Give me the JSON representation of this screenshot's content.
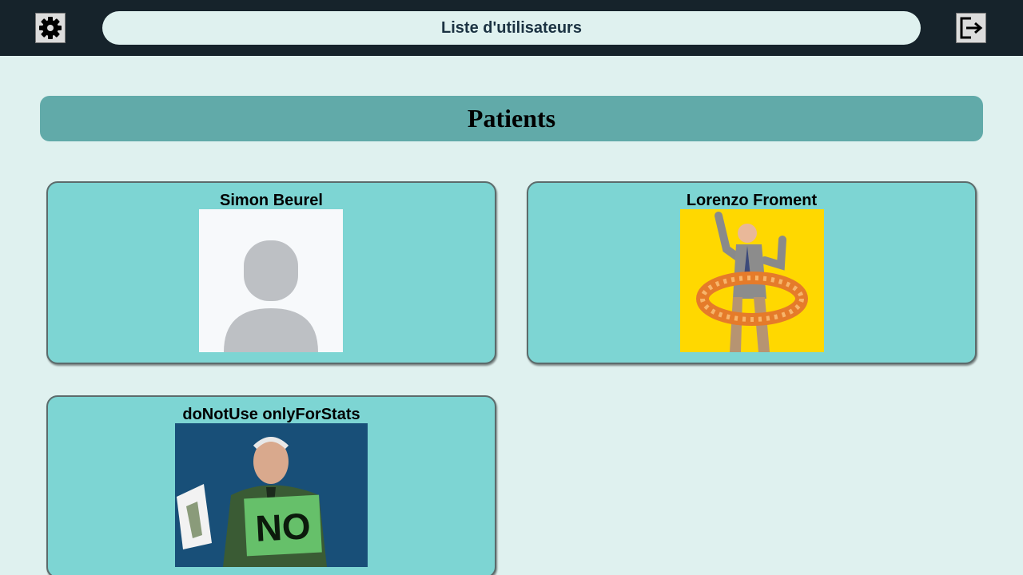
{
  "header": {
    "title": "Liste d'utilisateurs",
    "settings_icon": "gear-icon",
    "logout_icon": "logout-icon"
  },
  "section": {
    "title": "Patients"
  },
  "patients": [
    {
      "name": "Simon Beurel",
      "photo": "default-avatar-icon"
    },
    {
      "name": "Lorenzo Froment",
      "photo": "dancing-man-photo"
    },
    {
      "name": "doNotUse onlyForStats",
      "photo": "old-man-no-sign-photo"
    }
  ],
  "photo_no_sign_text": "NO",
  "colors": {
    "topbar": "#16232b",
    "background": "#dff1ef",
    "section_header": "#61aaa9",
    "card": "#7dd5d3"
  }
}
